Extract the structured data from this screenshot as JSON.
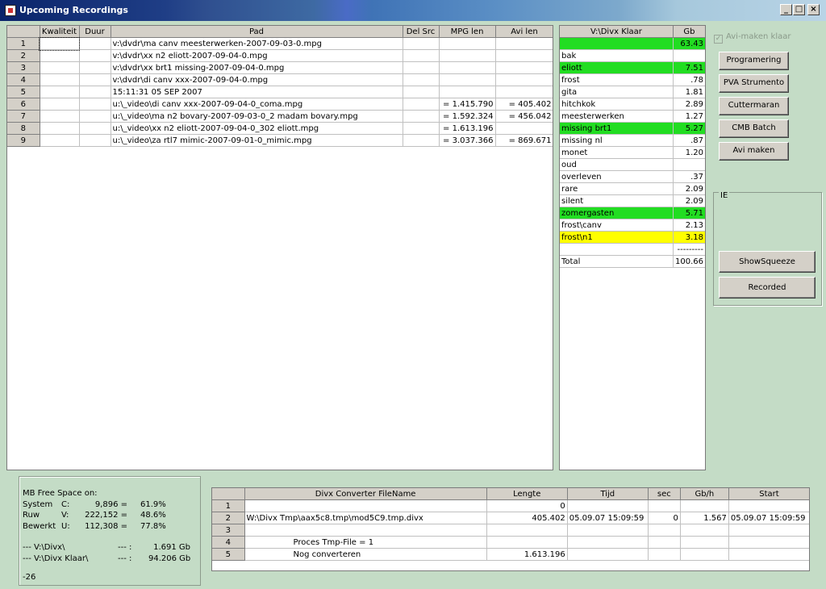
{
  "window": {
    "title": "Upcoming Recordings",
    "controls": {
      "minimize": "_",
      "maximize": "□",
      "close": "×"
    }
  },
  "recordings": {
    "columns": [
      "Kwaliteit",
      "Duur",
      "Pad",
      "Del Src",
      "MPG len",
      "Avi len"
    ],
    "rows": [
      {
        "num": "1",
        "kwaliteit": "",
        "duur": "",
        "pad": "v:\\dvdr\\ma canv meesterwerken-2007-09-03-0.mpg",
        "del_src": "",
        "mpg_len": "",
        "avi_len": ""
      },
      {
        "num": "2",
        "kwaliteit": "",
        "duur": "",
        "pad": "v:\\dvdr\\xx n2 eliott-2007-09-04-0.mpg",
        "del_src": "",
        "mpg_len": "",
        "avi_len": ""
      },
      {
        "num": "3",
        "kwaliteit": "",
        "duur": "",
        "pad": "v:\\dvdr\\xx brt1 missing-2007-09-04-0.mpg",
        "del_src": "",
        "mpg_len": "",
        "avi_len": ""
      },
      {
        "num": "4",
        "kwaliteit": "",
        "duur": "",
        "pad": "v:\\dvdr\\di canv xxx-2007-09-04-0.mpg",
        "del_src": "",
        "mpg_len": "",
        "avi_len": ""
      },
      {
        "num": "5",
        "kwaliteit": "",
        "duur": "",
        "pad": "15:11:31  05 SEP 2007",
        "del_src": "",
        "mpg_len": "",
        "avi_len": ""
      },
      {
        "num": "6",
        "kwaliteit": "",
        "duur": "",
        "pad": "u:\\_video\\di canv xxx-2007-09-04-0_coma.mpg",
        "del_src": "",
        "mpg_len": "= 1.415.790",
        "avi_len": "= 405.402"
      },
      {
        "num": "7",
        "kwaliteit": "",
        "duur": "",
        "pad": "u:\\_video\\ma n2 bovary-2007-09-03-0_2 madam bovary.mpg",
        "del_src": "",
        "mpg_len": "= 1.592.324",
        "avi_len": "= 456.042"
      },
      {
        "num": "8",
        "kwaliteit": "",
        "duur": "",
        "pad": "u:\\_video\\xx n2 eliott-2007-09-04-0_302 eliott.mpg",
        "del_src": "",
        "mpg_len": "= 1.613.196",
        "avi_len": ""
      },
      {
        "num": "9",
        "kwaliteit": "",
        "duur": "",
        "pad": "u:\\_video\\za rtl7 mimic-2007-09-01-0_mimic.mpg",
        "del_src": "",
        "mpg_len": "= 3.037.366",
        "avi_len": "= 869.671"
      }
    ]
  },
  "divx_klaar": {
    "columns": [
      "V:\\Divx Klaar",
      "Gb"
    ],
    "rows": [
      {
        "name": "",
        "gb": "63.43",
        "color": "#22dd22"
      },
      {
        "name": "bak",
        "gb": "",
        "color": ""
      },
      {
        "name": "eliott",
        "gb": "7.51",
        "color": "#22dd22"
      },
      {
        "name": "frost",
        "gb": ".78",
        "color": ""
      },
      {
        "name": "gita",
        "gb": "1.81",
        "color": ""
      },
      {
        "name": "hitchkok",
        "gb": "2.89",
        "color": ""
      },
      {
        "name": "meesterwerken",
        "gb": "1.27",
        "color": ""
      },
      {
        "name": "missing brt1",
        "gb": "5.27",
        "color": "#22dd22"
      },
      {
        "name": "missing nl",
        "gb": ".87",
        "color": ""
      },
      {
        "name": "monet",
        "gb": "1.20",
        "color": ""
      },
      {
        "name": "oud",
        "gb": "",
        "color": ""
      },
      {
        "name": "overleven",
        "gb": ".37",
        "color": ""
      },
      {
        "name": "rare",
        "gb": "2.09",
        "color": ""
      },
      {
        "name": "silent",
        "gb": "2.09",
        "color": ""
      },
      {
        "name": "zomergasten",
        "gb": "5.71",
        "color": "#22dd22"
      },
      {
        "name": "frost\\canv",
        "gb": "2.13",
        "color": ""
      },
      {
        "name": "frost\\n1",
        "gb": "3.18",
        "color": "#ffff00"
      },
      {
        "name": "",
        "gb": "---------",
        "color": ""
      },
      {
        "name": "Total",
        "gb": "100.66",
        "color": ""
      }
    ]
  },
  "side": {
    "checkbox_label": "Avi-maken klaar",
    "checkbox_mark": "✓",
    "buttons": [
      "Programering",
      "PVA Strumento",
      "Cuttermaran",
      "CMB Batch",
      "Avi maken"
    ],
    "ie_group": {
      "label": "IE",
      "buttons": [
        "ShowSqueeze",
        "Recorded"
      ]
    }
  },
  "free_space": {
    "header": "MB Free Space on:",
    "lines": [
      {
        "label": "System",
        "drive": "C:",
        "mb": "9,896 =",
        "pct": "61.9%"
      },
      {
        "label": "Ruw",
        "drive": "V:",
        "mb": "222,152 =",
        "pct": "48.6%"
      },
      {
        "label": "Bewerkt",
        "drive": "U:",
        "mb": "112,308 =",
        "pct": "77.8%"
      }
    ],
    "paths": [
      {
        "path": "--- V:\\Divx\\",
        "sep": "--- :",
        "value": "1.691 Gb"
      },
      {
        "path": "--- V:\\Divx Klaar\\",
        "sep": "--- :",
        "value": "94.206 Gb"
      }
    ],
    "footer": "-26"
  },
  "converter": {
    "columns": [
      "Divx Converter FileName",
      "Lengte",
      "Tijd",
      "sec",
      "Gb/h",
      "Start"
    ],
    "rows": [
      {
        "num": "1",
        "file": "",
        "lengte": "0",
        "tijd": "",
        "sec": "",
        "gbh": "",
        "start": ""
      },
      {
        "num": "2",
        "file": "W:\\Divx Tmp\\aax5c8.tmp\\mod5C9.tmp.divx",
        "lengte": "405.402",
        "tijd": "05.09.07 15:09:59",
        "sec": "0",
        "gbh": "1.567",
        "start": "05.09.07 15:09:59"
      },
      {
        "num": "3",
        "file": "",
        "lengte": "",
        "tijd": "",
        "sec": "",
        "gbh": "",
        "start": ""
      },
      {
        "num": "4",
        "file": "Proces Tmp-File = 1",
        "lengte": "",
        "tijd": "",
        "sec": "",
        "gbh": "",
        "start": ""
      },
      {
        "num": "5",
        "file": "Nog converteren",
        "lengte": "1.613.196",
        "tijd": "",
        "sec": "",
        "gbh": "",
        "start": ""
      }
    ]
  }
}
